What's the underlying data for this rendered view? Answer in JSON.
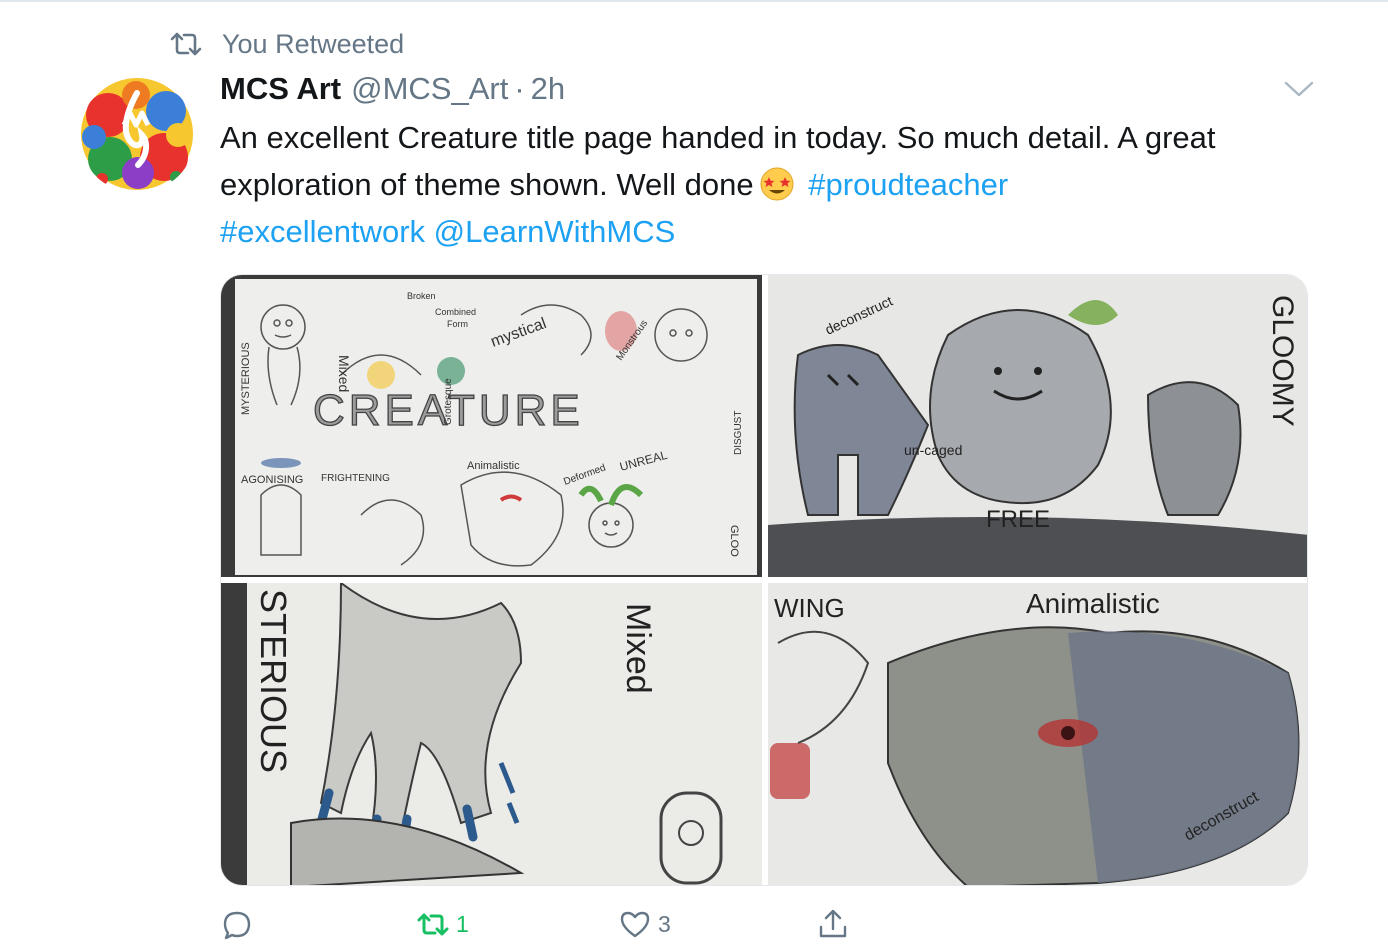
{
  "retweet_context": {
    "label": "You Retweeted"
  },
  "tweet": {
    "author_name": "MCS Art",
    "handle": "@MCS_Art",
    "separator": "·",
    "time": "2h",
    "text_part1": "An excellent Creature title page handed in today. So much detail. A great exploration of theme shown. Well done",
    "hashtag1": "#proudteacher",
    "hashtag2": "#excellentwork",
    "mention": "@LearnWithMCS",
    "media": {
      "panel1_words": [
        "MYSTERIOUS",
        "Mixed",
        "CREATURE",
        "Animalistic",
        "AGONISING",
        "FRIGHTENING",
        "Grotesque",
        "Combined",
        "Form",
        "Broken",
        "mystical",
        "Monstrous",
        "DISGUST",
        "Deformed",
        "UNREAL",
        "GLOO"
      ],
      "panel2_words": [
        "deconstruct",
        "GLOOMY",
        "un-caged",
        "FREE"
      ],
      "panel3_words": [
        "STERIOUS",
        "Mixed"
      ],
      "panel4_words": [
        "WING",
        "Animalistic",
        "deconstruct"
      ]
    }
  },
  "actions": {
    "reply_count": "",
    "retweet_count": "1",
    "like_count": "3",
    "colors": {
      "retweeted": "#17bf63",
      "muted": "#657786",
      "link": "#1da1f2"
    }
  },
  "icons": {
    "retweet_context": "retweet-icon",
    "menu": "chevron-down-icon",
    "reply": "reply-icon",
    "retweet": "retweet-icon",
    "like": "heart-icon",
    "share": "share-icon",
    "emoji": "star-struck-emoji"
  }
}
